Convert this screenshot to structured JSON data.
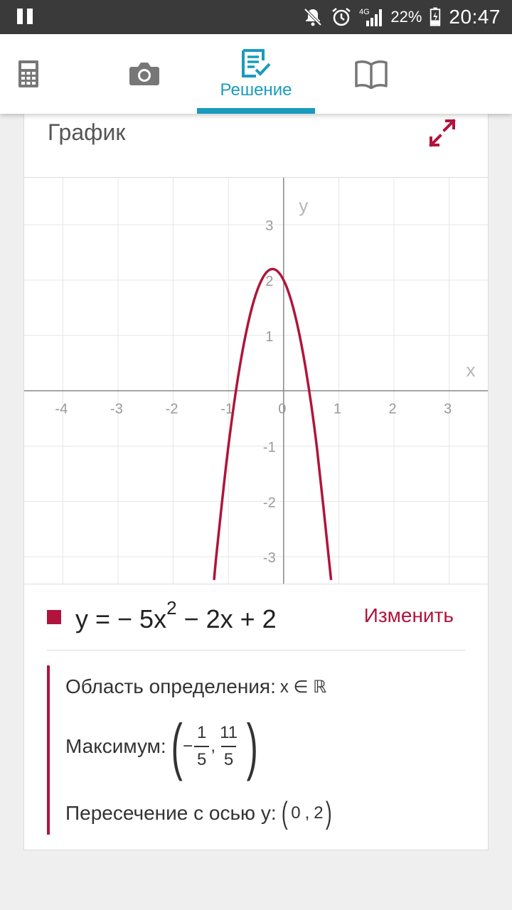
{
  "status_bar": {
    "battery": "22%",
    "time": "20:47",
    "network": "4G"
  },
  "tabs": [
    {
      "icon": "calculator-icon"
    },
    {
      "icon": "camera-icon"
    },
    {
      "icon": "solution-icon",
      "label": "Решение",
      "active": true
    },
    {
      "icon": "book-icon"
    }
  ],
  "card": {
    "title": "График"
  },
  "chart_data": {
    "type": "line",
    "xlabel": "x",
    "ylabel": "y",
    "xlim": [
      -4.7,
      3.7
    ],
    "ylim": [
      -3.5,
      3.85
    ],
    "x_ticks": [
      "-4",
      "-3",
      "-2",
      "-1",
      "0",
      "1",
      "2",
      "3"
    ],
    "y_ticks": [
      "3",
      "2",
      "1",
      "-1",
      "-2",
      "-3"
    ],
    "grid": true,
    "series": [
      {
        "function": "y = -5x^2 - 2x + 2",
        "color": "#b0143c",
        "x": [
          -1.26,
          -1.2,
          -1.0,
          -0.8,
          -0.6,
          -0.4,
          -0.2,
          0.0,
          0.2,
          0.4,
          0.6,
          0.86
        ],
        "y": [
          -3.42,
          -2.8,
          -1.0,
          0.4,
          1.4,
          2.0,
          2.2,
          2.0,
          1.4,
          0.4,
          -1.0,
          -3.42
        ]
      }
    ]
  },
  "legend": {
    "equation_prefix": "y = − 5x",
    "equation_power": "2",
    "equation_suffix": " − 2x + 2",
    "edit_label": "Изменить",
    "color": "#b0143c"
  },
  "properties": {
    "domain_label": "Область определения:",
    "domain_value": "x ∈ ℝ",
    "max_label": "Максимум:",
    "max_x_sign": "−",
    "max_x_num": "1",
    "max_x_den": "5",
    "max_y_num": "11",
    "max_y_den": "5",
    "yint_label": "Пересечение с осью y:",
    "yint_x": "0",
    "yint_y": "2"
  }
}
